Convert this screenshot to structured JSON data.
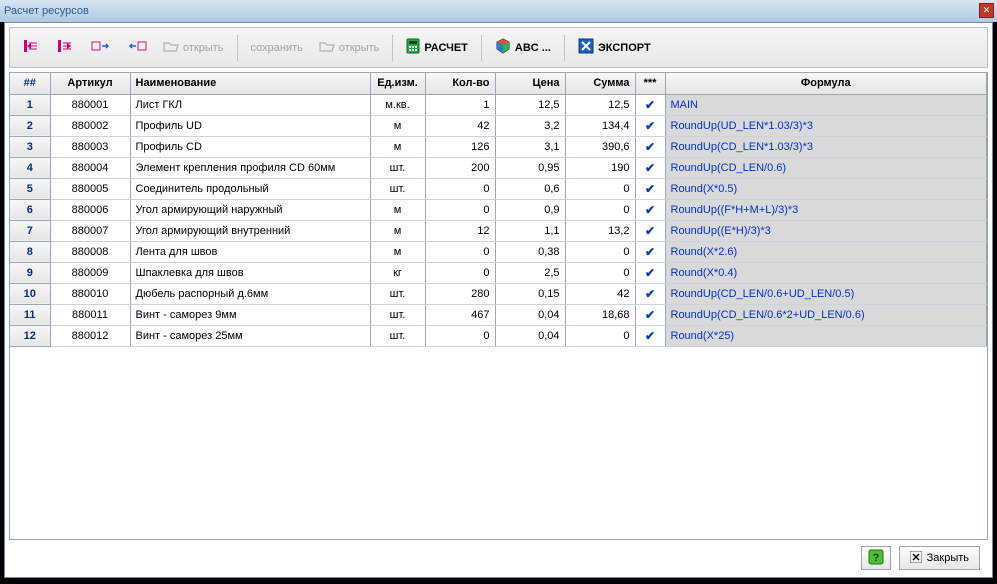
{
  "window": {
    "title": "Расчет ресурсов"
  },
  "toolbar": {
    "open1": "открыть",
    "save": "сохранить",
    "open2": "открыть",
    "calc": "РАСЧЕТ",
    "abc": "ABC ...",
    "export": "ЭКСПОРТ"
  },
  "columns": {
    "num": "##",
    "article": "Артикул",
    "name": "Наименование",
    "unit": "Ед.изм.",
    "qty": "Кол-во",
    "price": "Цена",
    "sum": "Сумма",
    "star": "***",
    "formula": "Формула"
  },
  "rows": [
    {
      "n": "1",
      "art": "880001",
      "name": "Лист ГКЛ",
      "unit": "м.кв.",
      "qty": "1",
      "price": "12,5",
      "sum": "12,5",
      "chk": true,
      "formula": "MAIN"
    },
    {
      "n": "2",
      "art": "880002",
      "name": "Профиль UD",
      "unit": "м",
      "qty": "42",
      "price": "3,2",
      "sum": "134,4",
      "chk": true,
      "formula": "RoundUp(UD_LEN*1.03/3)*3"
    },
    {
      "n": "3",
      "art": "880003",
      "name": "Профиль CD",
      "unit": "м",
      "qty": "126",
      "price": "3,1",
      "sum": "390,6",
      "chk": true,
      "formula": "RoundUp(CD_LEN*1.03/3)*3"
    },
    {
      "n": "4",
      "art": "880004",
      "name": "Элемент крепления профиля CD 60мм",
      "unit": "шт.",
      "qty": "200",
      "price": "0,95",
      "sum": "190",
      "chk": true,
      "formula": "RoundUp(CD_LEN/0.6)"
    },
    {
      "n": "5",
      "art": "880005",
      "name": "Соединитель продольный",
      "unit": "шт.",
      "qty": "0",
      "price": "0,6",
      "sum": "0",
      "chk": true,
      "formula": "Round(X*0.5)"
    },
    {
      "n": "6",
      "art": "880006",
      "name": "Угол армирующий наружный",
      "unit": "м",
      "qty": "0",
      "price": "0,9",
      "sum": "0",
      "chk": true,
      "formula": "RoundUp((F*H+M+L)/3)*3"
    },
    {
      "n": "7",
      "art": "880007",
      "name": "Угол армирующий внутренний",
      "unit": "м",
      "qty": "12",
      "price": "1,1",
      "sum": "13,2",
      "chk": true,
      "formula": "RoundUp((E*H)/3)*3"
    },
    {
      "n": "8",
      "art": "880008",
      "name": "Лента для швов",
      "unit": "м",
      "qty": "0",
      "price": "0,38",
      "sum": "0",
      "chk": true,
      "formula": "Round(X*2.6)"
    },
    {
      "n": "9",
      "art": "880009",
      "name": "Шпаклевка для швов",
      "unit": "кг",
      "qty": "0",
      "price": "2,5",
      "sum": "0",
      "chk": true,
      "formula": "Round(X*0.4)"
    },
    {
      "n": "10",
      "art": "880010",
      "name": "Дюбель распорный д.6мм",
      "unit": "шт.",
      "qty": "280",
      "price": "0,15",
      "sum": "42",
      "chk": true,
      "formula": "RoundUp(CD_LEN/0.6+UD_LEN/0.5)"
    },
    {
      "n": "11",
      "art": "880011",
      "name": "Винт - саморез 9мм",
      "unit": "шт.",
      "qty": "467",
      "price": "0,04",
      "sum": "18,68",
      "chk": true,
      "formula": "RoundUp(CD_LEN/0.6*2+UD_LEN/0.6)"
    },
    {
      "n": "12",
      "art": "880012",
      "name": "Винт - саморез 25мм",
      "unit": "шт.",
      "qty": "0",
      "price": "0,04",
      "sum": "0",
      "chk": true,
      "formula": "Round(X*25)"
    }
  ],
  "footer": {
    "close": "Закрыть"
  }
}
